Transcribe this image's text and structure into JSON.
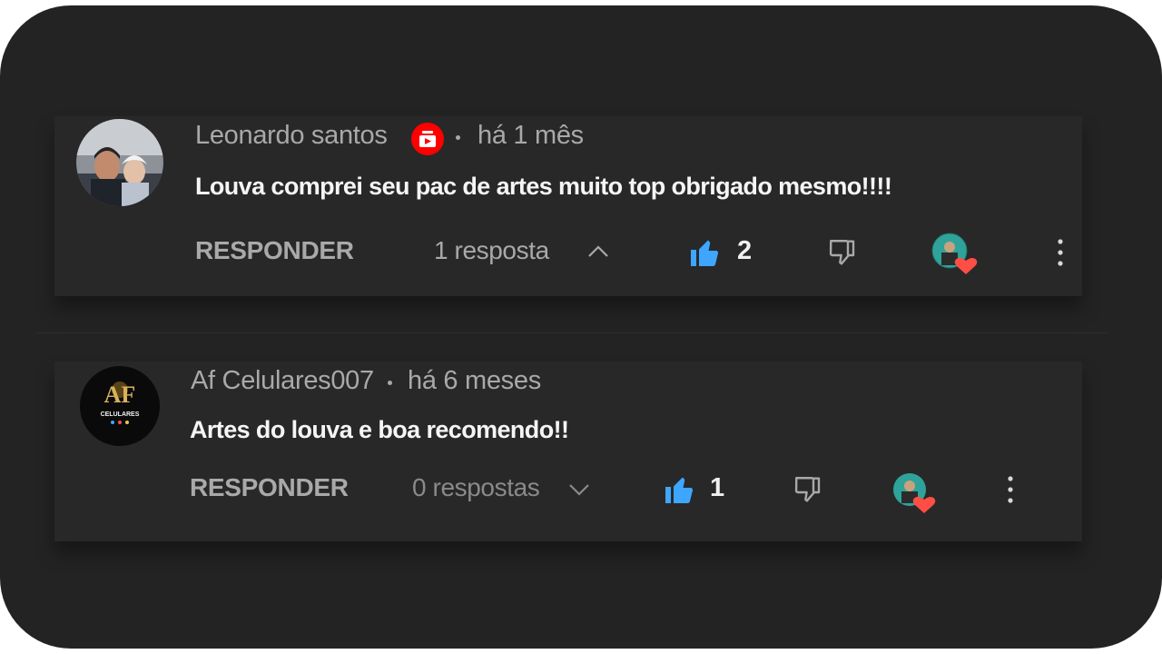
{
  "comments": [
    {
      "author": "Leonardo santos",
      "has_badge": true,
      "time": "há 1 mês",
      "text": "Louva comprei seu pac de artes muito top obrigado mesmo!!!!",
      "reply_label": "RESPONDER",
      "replies_label": "1 resposta",
      "replies_expanded": true,
      "likes": "2"
    },
    {
      "author": "Af Celulares007",
      "avatar_text": "CELULARES",
      "avatar_initials": "AF",
      "time": "há 6 meses",
      "text": "Artes do louva e boa recomendo!!",
      "reply_label": "RESPONDER",
      "replies_label": "0 respostas",
      "replies_expanded": false,
      "likes": "1"
    }
  ],
  "colors": {
    "background": "#232323",
    "card": "#282828",
    "like_blue": "#3ea6ff",
    "heart_red": "#ff4e45",
    "badge_red": "#ff0000"
  },
  "icons": [
    "youtube-badge-icon",
    "thumbs-up-icon",
    "thumbs-down-icon",
    "creator-heart-icon",
    "more-vert-icon",
    "chevron-up-icon",
    "chevron-down-icon"
  ]
}
